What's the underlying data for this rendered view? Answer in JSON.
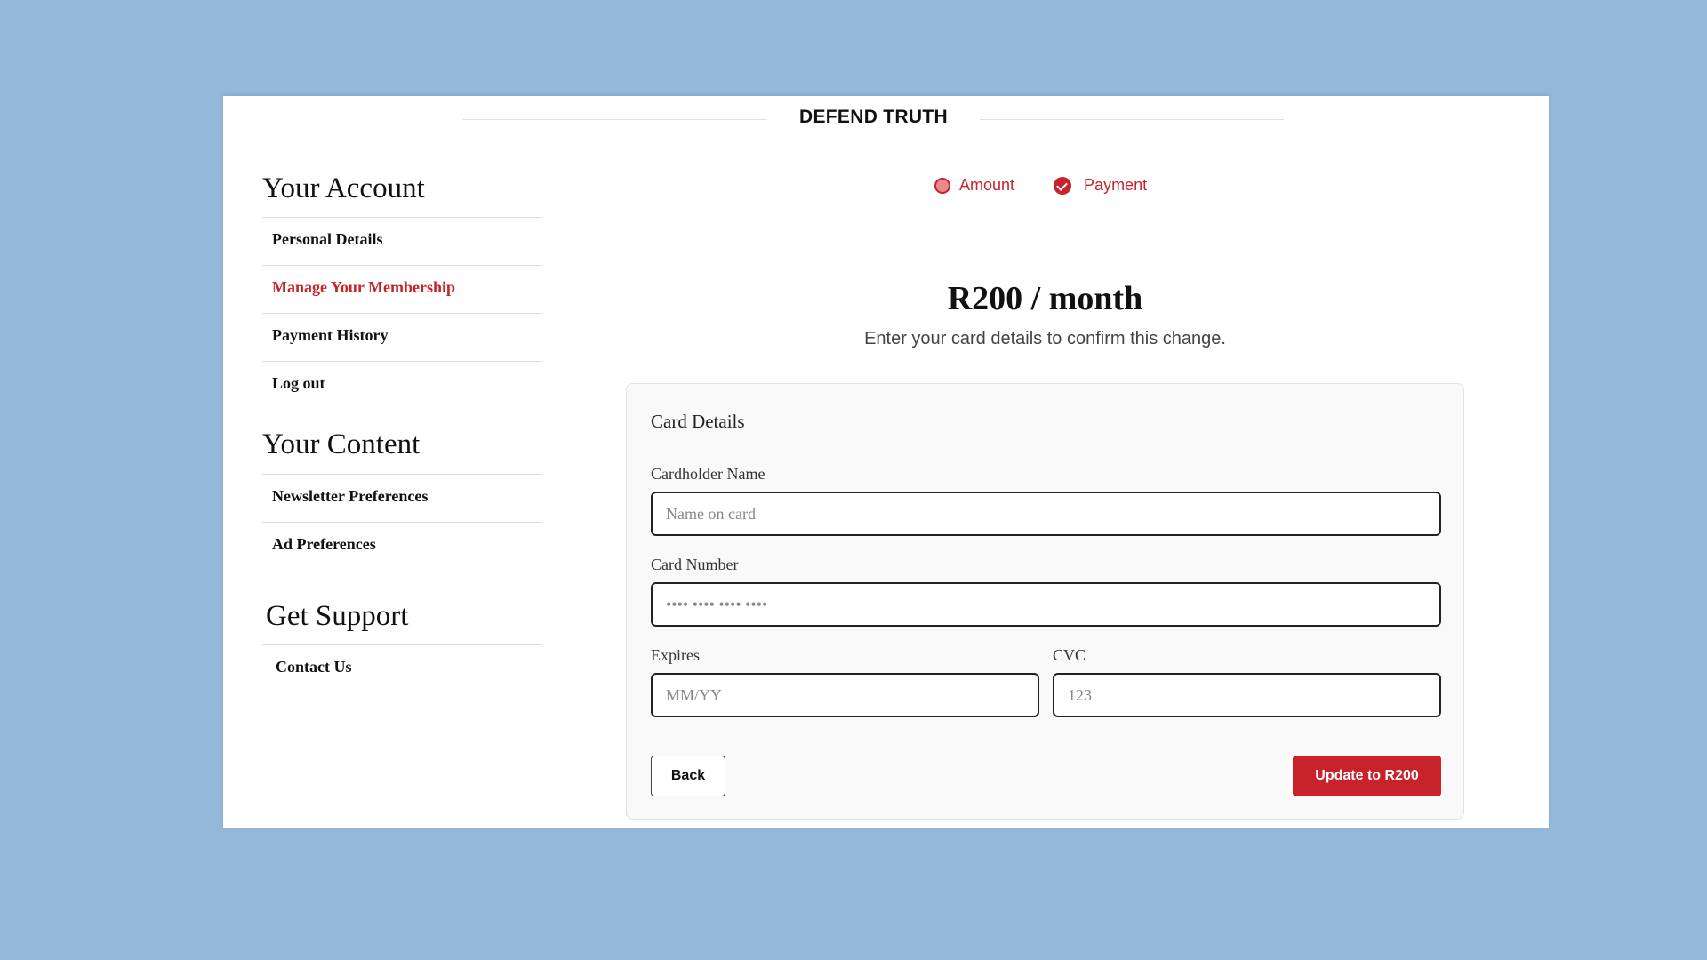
{
  "header": {
    "brand": "DEFEND TRUTH"
  },
  "sidebar": {
    "account": {
      "heading": "Your Account",
      "items": [
        {
          "label": "Personal Details"
        },
        {
          "label": "Manage Your Membership",
          "active": true
        },
        {
          "label": "Payment History"
        },
        {
          "label": "Log out"
        }
      ]
    },
    "content": {
      "heading": "Your Content",
      "items": [
        {
          "label": "Newsletter Preferences"
        },
        {
          "label": "Ad Preferences"
        }
      ]
    },
    "support": {
      "heading": "Get Support",
      "items": [
        {
          "label": "Contact Us"
        }
      ]
    }
  },
  "steps": [
    {
      "label": "Amount",
      "state": "done"
    },
    {
      "label": "Payment",
      "state": "current"
    }
  ],
  "main": {
    "price": "R200 / month",
    "subtitle": "Enter your card details to confirm this change."
  },
  "card": {
    "title": "Card Details",
    "cardholder": {
      "label": "Cardholder Name",
      "placeholder": "Name on card",
      "value": ""
    },
    "number": {
      "label": "Card Number",
      "placeholder": "•••• •••• •••• ••••",
      "value": ""
    },
    "expires": {
      "label": "Expires",
      "placeholder": "MM/YY",
      "value": ""
    },
    "cvc": {
      "label": "CVC",
      "placeholder": "123",
      "value": ""
    },
    "back_label": "Back",
    "update_label": "Update to R200"
  },
  "colors": {
    "accent": "#c8222a",
    "background": "#93b8d9"
  }
}
